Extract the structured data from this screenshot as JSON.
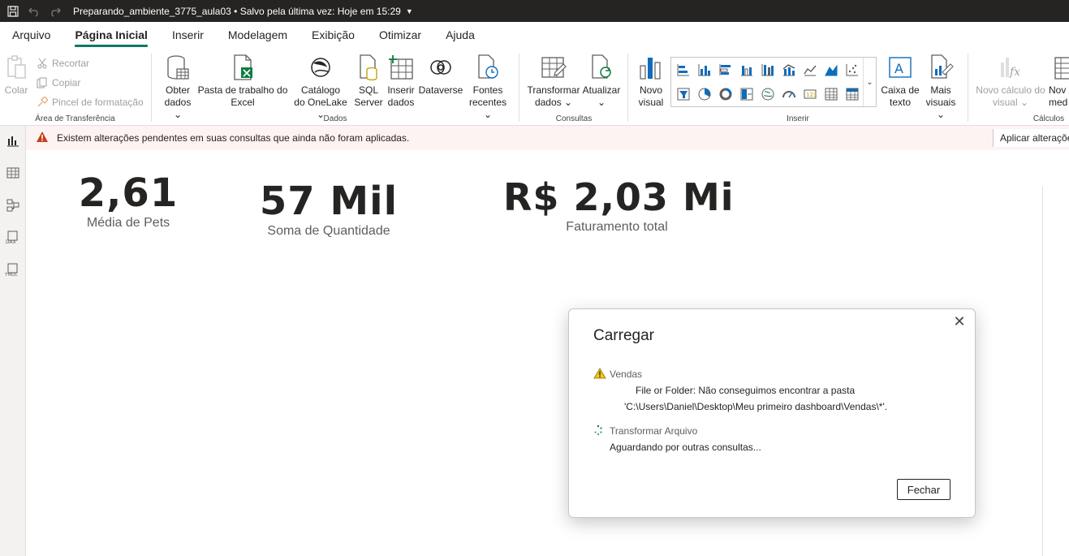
{
  "titlebar": {
    "title": "Preparando_ambiente_3775_aula03 • Salvo pela última vez: Hoje em 15:29",
    "caret": "▼"
  },
  "menu": {
    "tabs": [
      "Arquivo",
      "Página Inicial",
      "Inserir",
      "Modelagem",
      "Exibição",
      "Otimizar",
      "Ajuda"
    ],
    "active": "Página Inicial"
  },
  "ribbon": {
    "clipboard": {
      "label": "Área de Transferência",
      "paste": "Colar",
      "cut": "Recortar",
      "copy": "Copiar",
      "format_painter": "Pincel de formatação"
    },
    "data": {
      "label": "Dados",
      "get_data_1": "Obter",
      "get_data_2": "dados ⌄",
      "excel_1": "Pasta de trabalho do",
      "excel_2": "Excel",
      "onelake_1": "Catálogo",
      "onelake_2": "do OneLake ⌄",
      "sql_1": "SQL",
      "sql_2": "Server",
      "enter_1": "Inserir",
      "enter_2": "dados",
      "dataverse": "Dataverse",
      "recent_1": "Fontes",
      "recent_2": "recentes ⌄"
    },
    "queries": {
      "label": "Consultas",
      "transform_1": "Transformar",
      "transform_2": "dados ⌄",
      "refresh_1": "Atualizar",
      "refresh_2": "⌄"
    },
    "insert": {
      "label": "Inserir",
      "new_visual_1": "Novo",
      "new_visual_2": "visual",
      "textbox_1": "Caixa de",
      "textbox_2": "texto",
      "more_visuals_1": "Mais",
      "more_visuals_2": "visuais ⌄"
    },
    "calc": {
      "label": "Cálculos",
      "new_calc_1": "Novo cálculo do",
      "new_calc_2": "visual ⌄",
      "new_measure_1": "Nov",
      "new_measure_2": "med"
    }
  },
  "notification": {
    "message": "Existem alterações pendentes em suas consultas que ainda não foram aplicadas.",
    "apply": "Aplicar alterações"
  },
  "kpis": [
    {
      "value": "2,61",
      "label": "Média de Pets"
    },
    {
      "value": "57 Mil",
      "label": "Soma de Quantidade"
    },
    {
      "value": "R$ 2,03 Mi",
      "label": "Faturamento total"
    }
  ],
  "dialog": {
    "title": "Carregar",
    "items": [
      {
        "name": "Vendas",
        "line1": "File or Folder: Não conseguimos encontrar a pasta",
        "line2": "'C:\\Users\\Daniel\\Desktop\\Meu primeiro dashboard\\Vendas\\*'."
      },
      {
        "name": "Transformar Arquivo",
        "line1": "Aguardando por outras consultas..."
      }
    ],
    "close_label": "Fechar"
  },
  "colors": {
    "accent": "#117865",
    "warning": "#c43e1c",
    "warning_yellow": "#f2c811"
  }
}
